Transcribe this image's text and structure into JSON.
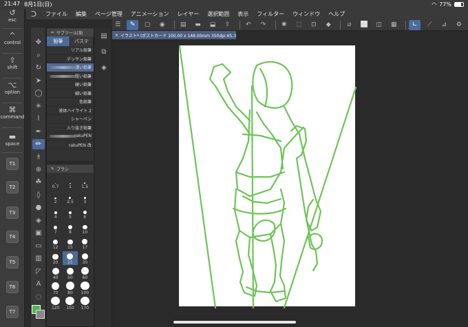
{
  "status": {
    "time": "21:47",
    "date": "8月1日(日)",
    "battery": "77%"
  },
  "menu": {
    "items": [
      "ファイル",
      "編集",
      "ページ管理",
      "アニメーション",
      "レイヤー",
      "選択範囲",
      "表示",
      "フィルター",
      "ウィンドウ",
      "ヘルプ"
    ]
  },
  "modifiers": {
    "esc": "esc",
    "control": "control",
    "shift": "shift",
    "option": "option",
    "command": "command",
    "space": "space",
    "t1": "T1",
    "t2": "T2",
    "t3": "T3",
    "t4": "T4",
    "t5": "T5",
    "t6": "T6",
    "t7": "T7"
  },
  "document": {
    "tab_title": "イラスト* (ポストカード 100.00 x 148.00mm 350dpi 65.3%)"
  },
  "subtool": {
    "title": "サブツール[鉛",
    "tabs": [
      "鉛筆",
      "パステ"
    ],
    "brushes": [
      "リアル鉛筆",
      "デッサン鉛筆",
      "濃い鉛筆",
      "粗い鉛筆",
      "硬い鉛筆",
      "細い鉛筆",
      "色鉛筆",
      "液体ハイライト 2",
      "シャーペン",
      "入り抜き鉛筆",
      "rakuPEN",
      "rakuPEN 改"
    ],
    "selected_index": 2
  },
  "brushsize": {
    "title": "ブラシ",
    "sizes": [
      "0.7",
      "1",
      "1.5",
      "2",
      "2.5",
      "3",
      "4",
      "5",
      "6",
      "7",
      "8",
      "10",
      "12",
      "15",
      "17",
      "20",
      "25",
      "30",
      "40",
      "50",
      "60",
      "70",
      "80",
      "100",
      "120",
      "150",
      "170"
    ],
    "selected": "25"
  },
  "colors": {
    "main": "#4cba4a",
    "sub": "#888888",
    "accent": "#4d6a99",
    "stroke": "#6cc455"
  }
}
